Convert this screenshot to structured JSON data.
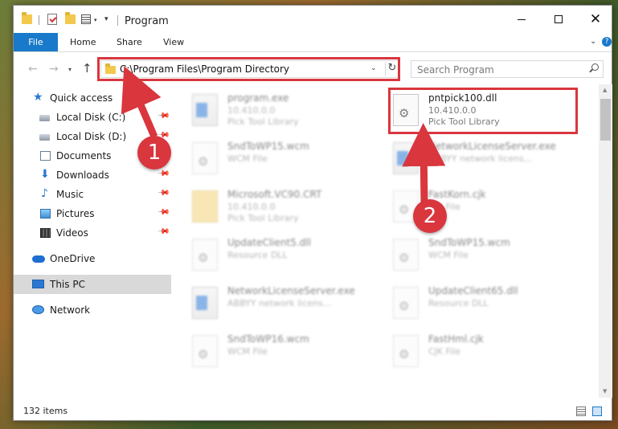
{
  "window": {
    "title": "Program"
  },
  "ribbon": {
    "tabs": [
      "File",
      "Home",
      "Share",
      "View"
    ]
  },
  "nav": {
    "address": "C:\\Program Files\\Program Directory",
    "search_placeholder": "Search Program"
  },
  "sidebar": {
    "items": [
      {
        "label": "Quick access",
        "icon": "star-icon",
        "pinned": false
      },
      {
        "label": "Local Disk (C:)",
        "icon": "drive-icon",
        "pinned": true
      },
      {
        "label": "Local Disk (D:)",
        "icon": "drive-icon",
        "pinned": true
      },
      {
        "label": "Documents",
        "icon": "documents-icon",
        "pinned": true
      },
      {
        "label": "Downloads",
        "icon": "download-icon",
        "pinned": true
      },
      {
        "label": "Music",
        "icon": "music-icon",
        "pinned": true
      },
      {
        "label": "Pictures",
        "icon": "pictures-icon",
        "pinned": true
      },
      {
        "label": "Videos",
        "icon": "videos-icon",
        "pinned": true
      },
      {
        "label": "OneDrive",
        "icon": "cloud-icon",
        "pinned": false
      },
      {
        "label": "This PC",
        "icon": "computer-icon",
        "pinned": false,
        "selected": true
      },
      {
        "label": "Network",
        "icon": "network-icon",
        "pinned": false
      }
    ]
  },
  "files": [
    {
      "name": "program.exe",
      "line2": "10.410.0.0",
      "line3": "Pick Tool Library",
      "icon": "exe",
      "highlight": false
    },
    {
      "name": "pntpick100.dll",
      "line2": "10.410.0.0",
      "line3": "Pick Tool Library",
      "icon": "dll",
      "highlight": true
    },
    {
      "name": "SndToWP15.wcm",
      "line2": "WCM File",
      "line3": "",
      "icon": "gear",
      "highlight": false
    },
    {
      "name": "NetworkLicenseServer.exe",
      "line2": "ABBYY network licens...",
      "line3": "",
      "icon": "exe",
      "highlight": false
    },
    {
      "name": "Microsoft.VC90.CRT",
      "line2": "10.410.0.0",
      "line3": "Pick Tool Library",
      "icon": "appfolder",
      "highlight": false
    },
    {
      "name": "FastKorn.cjk",
      "line2": "CJK File",
      "line3": "",
      "icon": "gear",
      "highlight": false
    },
    {
      "name": "UpdateClient5.dll",
      "line2": "Resource DLL",
      "line3": "",
      "icon": "dll",
      "highlight": false
    },
    {
      "name": "SndToWP15.wcm",
      "line2": "WCM File",
      "line3": "",
      "icon": "gear",
      "highlight": false
    },
    {
      "name": "NetworkLicenseServer.exe",
      "line2": "ABBYY network licens...",
      "line3": "",
      "icon": "exe",
      "highlight": false
    },
    {
      "name": "UpdateClient65.dll",
      "line2": "Resource DLL",
      "line3": "",
      "icon": "dll",
      "highlight": false
    },
    {
      "name": "SndToWP16.wcm",
      "line2": "WCM File",
      "line3": "",
      "icon": "gear",
      "highlight": false
    },
    {
      "name": "FastHml.cjk",
      "line2": "CJK File",
      "line3": "",
      "icon": "gear",
      "highlight": false
    }
  ],
  "status": {
    "item_count": "132 items"
  },
  "annotations": [
    {
      "label": "1"
    },
    {
      "label": "2"
    }
  ],
  "colors": {
    "accent": "#1979ca",
    "annotation": "#d9363e"
  }
}
